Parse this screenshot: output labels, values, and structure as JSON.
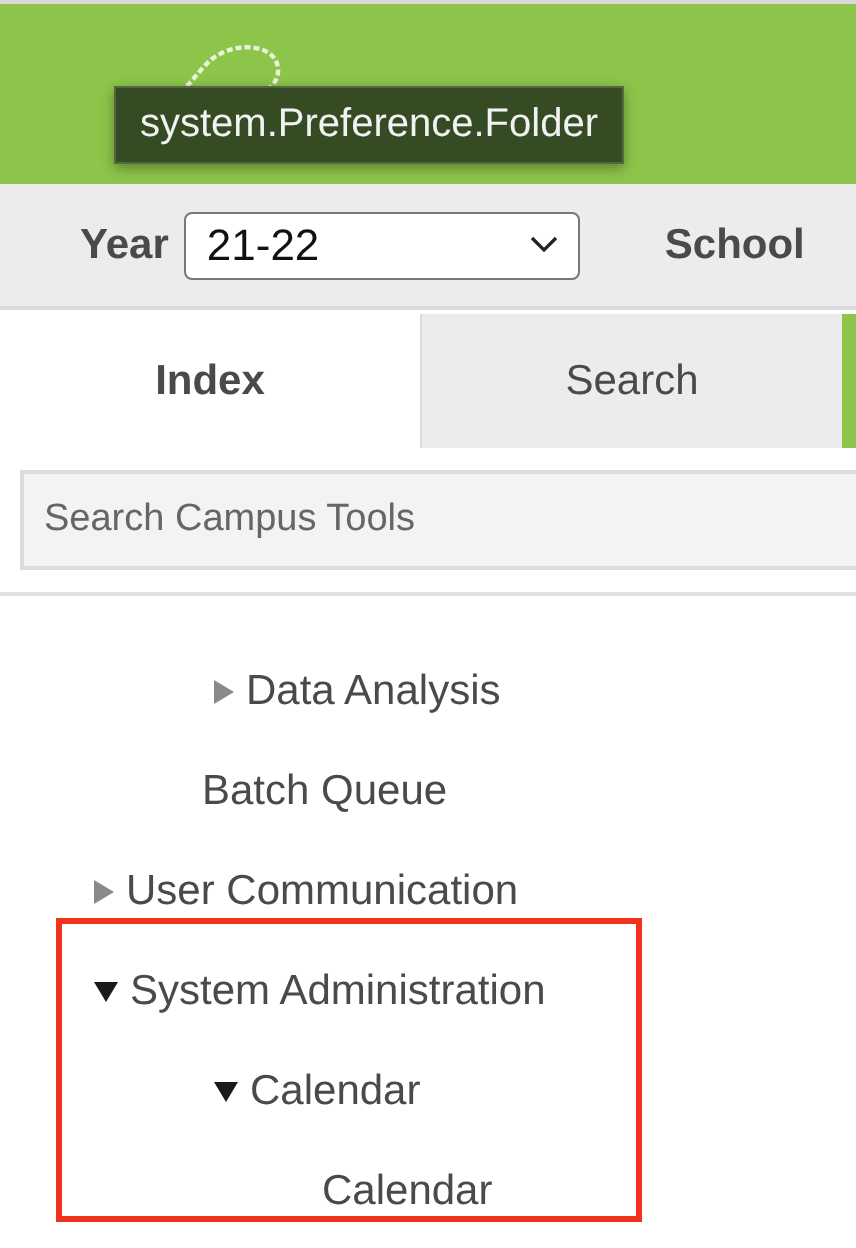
{
  "header": {
    "tooltip": "system.Preference.Folder"
  },
  "context_bar": {
    "year_label": "Year",
    "year_value": "21-22",
    "school_label": "School"
  },
  "tabs": [
    {
      "label": "Index",
      "selected": true
    },
    {
      "label": "Search",
      "selected": false
    }
  ],
  "search": {
    "placeholder": "Search Campus Tools"
  },
  "tree": [
    {
      "children": [
        {
          "kind": "folder",
          "label": "Data Analysis",
          "expanded": false
        },
        {
          "kind": "item",
          "label": "Batch Queue"
        }
      ]
    },
    {
      "kind": "folder",
      "label": "User Communication",
      "expanded": false
    },
    {
      "kind": "folder",
      "label": "System Administration",
      "expanded": true,
      "highlighted": true,
      "children": [
        {
          "kind": "folder",
          "label": "Calendar",
          "expanded": true,
          "children": [
            {
              "kind": "item",
              "label": "Calendar"
            }
          ]
        }
      ]
    }
  ]
}
